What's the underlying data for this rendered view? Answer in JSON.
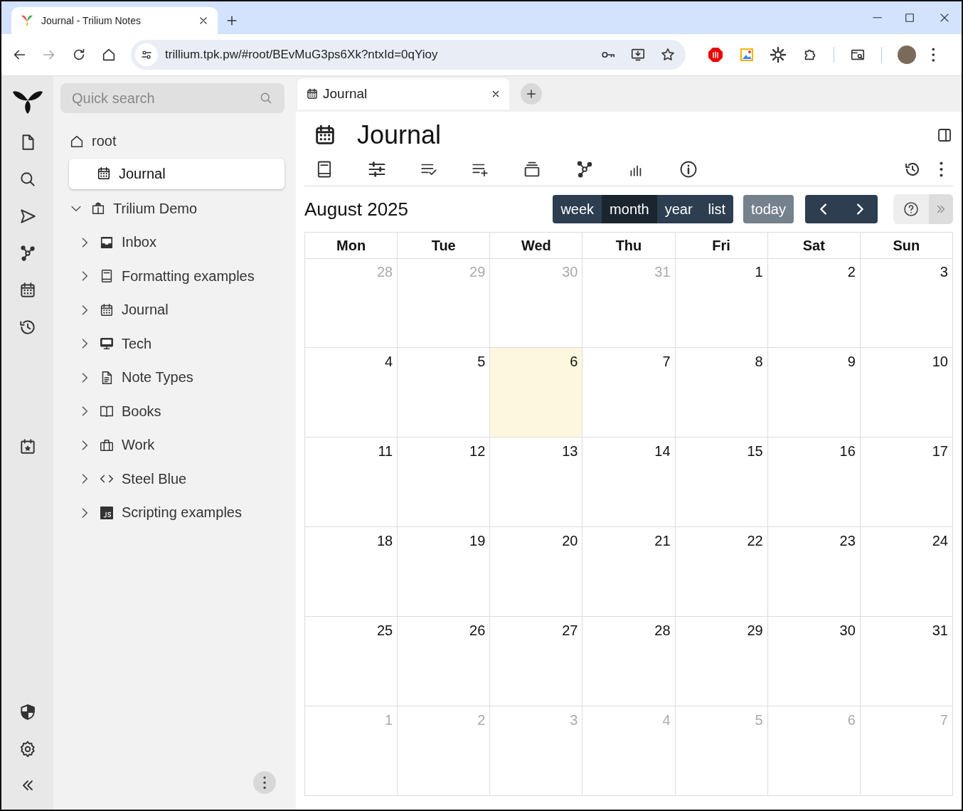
{
  "browser": {
    "tab_title": "Journal - Trilium Notes",
    "url": "trillium.tpk.pw/#root/BEvMuG3ps6Xk?ntxId=0qYioy"
  },
  "quick_search": {
    "placeholder": "Quick search"
  },
  "tree": {
    "label": "root",
    "children": [
      {
        "label": "Journal",
        "selected": true,
        "expanded": false
      },
      {
        "label": "Trilium Demo",
        "selected": false,
        "expanded": true,
        "children": [
          {
            "label": "Inbox",
            "selected": false,
            "expanded": false
          },
          {
            "label": "Formatting examples",
            "selected": false,
            "expanded": false
          },
          {
            "label": "Journal",
            "selected": false,
            "expanded": false
          },
          {
            "label": "Tech",
            "selected": false,
            "expanded": false
          },
          {
            "label": "Note Types",
            "selected": false,
            "expanded": false
          },
          {
            "label": "Books",
            "selected": false,
            "expanded": false
          },
          {
            "label": "Work",
            "selected": false,
            "expanded": false
          },
          {
            "label": "Steel Blue",
            "selected": false,
            "expanded": false
          },
          {
            "label": "Scripting examples",
            "selected": false,
            "expanded": false
          }
        ]
      }
    ]
  },
  "note_tabs": [
    {
      "label": "Journal",
      "selected": true
    }
  ],
  "note": {
    "title": "Journal"
  },
  "calendar": {
    "title": "August 2025",
    "views": [
      {
        "label": "week",
        "selected": false
      },
      {
        "label": "month",
        "selected": true
      },
      {
        "label": "year",
        "selected": false
      },
      {
        "label": "list",
        "selected": false
      }
    ],
    "today_button": {
      "label": "today",
      "disabled": true
    },
    "weekdays": [
      "Mon",
      "Tue",
      "Wed",
      "Thu",
      "Fri",
      "Sat",
      "Sun"
    ],
    "weeks": [
      [
        {
          "day": "28",
          "other_month": true,
          "today": false
        },
        {
          "day": "29",
          "other_month": true,
          "today": false
        },
        {
          "day": "30",
          "other_month": true,
          "today": false
        },
        {
          "day": "31",
          "other_month": true,
          "today": false
        },
        {
          "day": "1",
          "other_month": false,
          "today": false
        },
        {
          "day": "2",
          "other_month": false,
          "today": false
        },
        {
          "day": "3",
          "other_month": false,
          "today": false
        }
      ],
      [
        {
          "day": "4",
          "other_month": false,
          "today": false
        },
        {
          "day": "5",
          "other_month": false,
          "today": false
        },
        {
          "day": "6",
          "other_month": false,
          "today": true
        },
        {
          "day": "7",
          "other_month": false,
          "today": false
        },
        {
          "day": "8",
          "other_month": false,
          "today": false
        },
        {
          "day": "9",
          "other_month": false,
          "today": false
        },
        {
          "day": "10",
          "other_month": false,
          "today": false
        }
      ],
      [
        {
          "day": "11",
          "other_month": false,
          "today": false
        },
        {
          "day": "12",
          "other_month": false,
          "today": false
        },
        {
          "day": "13",
          "other_month": false,
          "today": false
        },
        {
          "day": "14",
          "other_month": false,
          "today": false
        },
        {
          "day": "15",
          "other_month": false,
          "today": false
        },
        {
          "day": "16",
          "other_month": false,
          "today": false
        },
        {
          "day": "17",
          "other_month": false,
          "today": false
        }
      ],
      [
        {
          "day": "18",
          "other_month": false,
          "today": false
        },
        {
          "day": "19",
          "other_month": false,
          "today": false
        },
        {
          "day": "20",
          "other_month": false,
          "today": false
        },
        {
          "day": "21",
          "other_month": false,
          "today": false
        },
        {
          "day": "22",
          "other_month": false,
          "today": false
        },
        {
          "day": "23",
          "other_month": false,
          "today": false
        },
        {
          "day": "24",
          "other_month": false,
          "today": false
        }
      ],
      [
        {
          "day": "25",
          "other_month": false,
          "today": false
        },
        {
          "day": "26",
          "other_month": false,
          "today": false
        },
        {
          "day": "27",
          "other_month": false,
          "today": false
        },
        {
          "day": "28",
          "other_month": false,
          "today": false
        },
        {
          "day": "29",
          "other_month": false,
          "today": false
        },
        {
          "day": "30",
          "other_month": false,
          "today": false
        },
        {
          "day": "31",
          "other_month": false,
          "today": false
        }
      ],
      [
        {
          "day": "1",
          "other_month": true,
          "today": false
        },
        {
          "day": "2",
          "other_month": true,
          "today": false
        },
        {
          "day": "3",
          "other_month": true,
          "today": false
        },
        {
          "day": "4",
          "other_month": true,
          "today": false
        },
        {
          "day": "5",
          "other_month": true,
          "today": false
        },
        {
          "day": "6",
          "other_month": true,
          "today": false
        },
        {
          "day": "7",
          "other_month": true,
          "today": false
        }
      ]
    ]
  }
}
